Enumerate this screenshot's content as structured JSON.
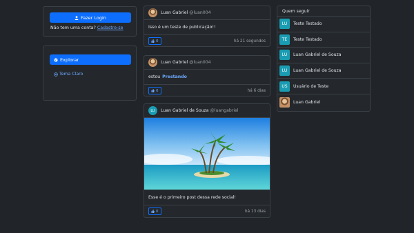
{
  "login": {
    "button_label": "Fazer Login",
    "no_account_text": "Não tem uma conta?",
    "signup_link": "Cadastre-se"
  },
  "explore": {
    "button_label": "Explorar",
    "theme_label": "Tema Claro"
  },
  "posts": [
    {
      "author": "Luan Gabriel",
      "handle": "@luan004",
      "text": "Isso é um teste de publicação!!",
      "likes": "0",
      "time": "há 21 segundos",
      "avatar": "photo"
    },
    {
      "author": "Luan Gabriel",
      "handle": "@luan004",
      "text_prefix": "estou",
      "text_highlight": "Prestando",
      "likes": "0",
      "time": "há 6 dias",
      "avatar": "photo"
    },
    {
      "author": "Luan Gabriel de Souza",
      "handle": "@luangabriel",
      "avatar_initials": "LU",
      "text": "Esse é o primeiro post dessa rede social!",
      "likes": "0",
      "time": "há 13 dias"
    }
  ],
  "follow": {
    "title": "Quem seguir",
    "items": [
      {
        "initials": "LU",
        "name": "Teste Testado"
      },
      {
        "initials": "TE",
        "name": "Teste Testado"
      },
      {
        "initials": "LU",
        "name": "Luan Gabriel de Souza"
      },
      {
        "initials": "LU",
        "name": "Luan Gabriel de Souza"
      },
      {
        "initials": "US",
        "name": "Usuário de Teste"
      },
      {
        "initials": "",
        "name": "Luan Gabriel"
      }
    ]
  },
  "colors": {
    "background": "#212529",
    "card": "#24282c",
    "border": "#3b4047",
    "primary": "#0d6efd",
    "link": "#6ea8fe",
    "avatar": "#1a9db2"
  },
  "icons": {
    "user": "user-icon",
    "globe": "globe-icon",
    "theme": "theme-icon",
    "like": "thumbs-up-icon"
  }
}
